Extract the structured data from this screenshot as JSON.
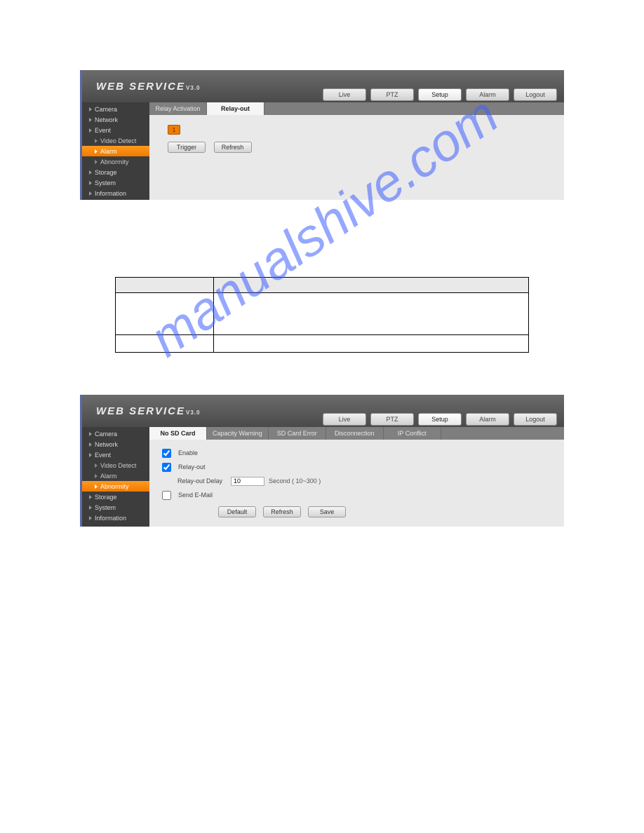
{
  "watermark": "manualshive.com",
  "brand_text": "WEB  SERVICE",
  "brand_ver": "V3.0",
  "topnav": {
    "live": "Live",
    "ptz": "PTZ",
    "setup": "Setup",
    "alarm": "Alarm",
    "logout": "Logout"
  },
  "sidebar": {
    "camera": "Camera",
    "network": "Network",
    "event": "Event",
    "video_detect": "Video Detect",
    "alarm": "Alarm",
    "abnormity": "Abnormity",
    "storage": "Storage",
    "system": "System",
    "information": "Information"
  },
  "shot1": {
    "tabs": {
      "relay_activation": "Relay Activation",
      "relay_out": "Relay-out"
    },
    "chip": "1",
    "trigger": "Trigger",
    "refresh": "Refresh"
  },
  "shot2": {
    "tabs": {
      "no_sd": "No SD Card",
      "cap_warn": "Capacity Warning",
      "sd_err": "SD Card Error",
      "disc": "Disconnection",
      "ip_conflict": "IP Conflict"
    },
    "enable": "Enable",
    "relay_out": "Relay-out",
    "relay_delay_lbl": "Relay-out Delay",
    "relay_delay_val": "10",
    "relay_delay_hint": "Second ( 10~300 )",
    "send_email": "Send E-Mail",
    "default": "Default",
    "refresh": "Refresh",
    "save": "Save"
  },
  "table": {
    "header1": "",
    "header2": "",
    "r1c1": "",
    "r1c2": "",
    "r2c1": "",
    "r2c2": ""
  }
}
